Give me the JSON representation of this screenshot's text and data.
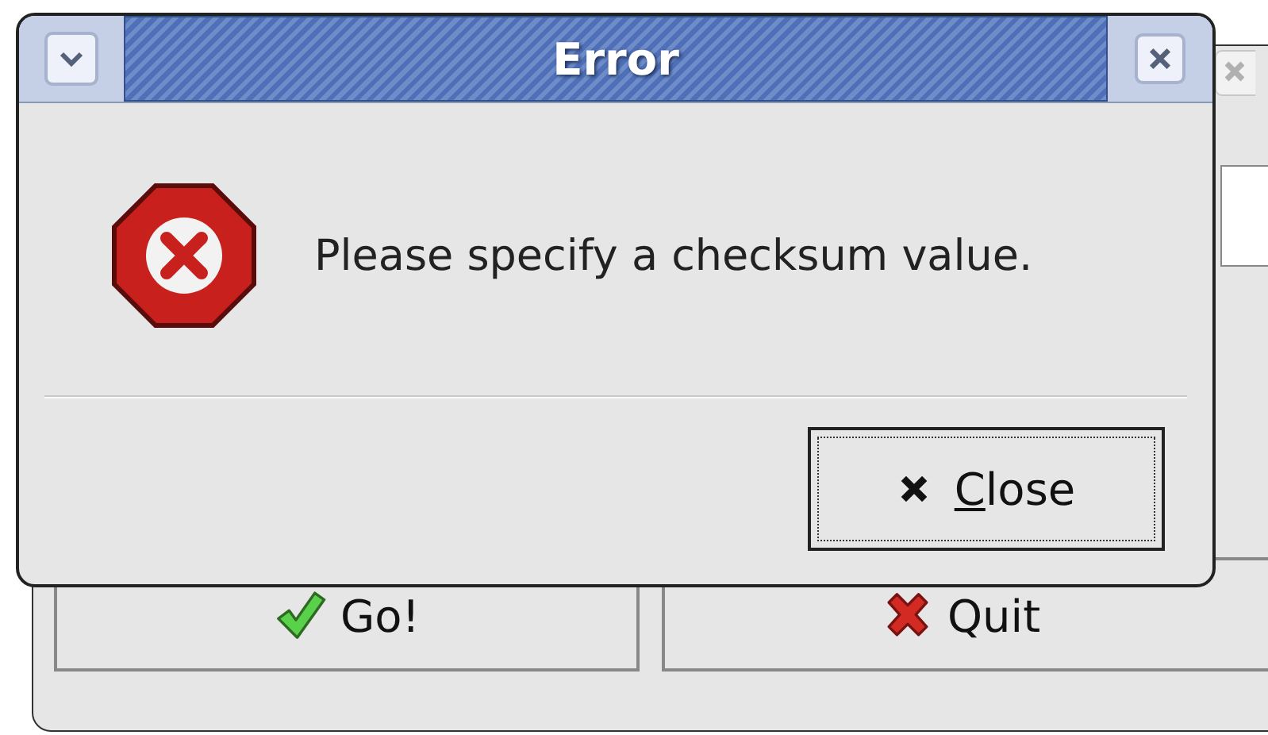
{
  "background_window": {
    "buttons": [
      {
        "label": "Go!",
        "kind": "go"
      },
      {
        "label": "Quit",
        "kind": "quit"
      }
    ]
  },
  "dialog": {
    "title": "Error",
    "message": "Please specify a checksum value.",
    "buttons": [
      {
        "label": "Close",
        "mnemonic": true,
        "focused": true
      }
    ]
  }
}
